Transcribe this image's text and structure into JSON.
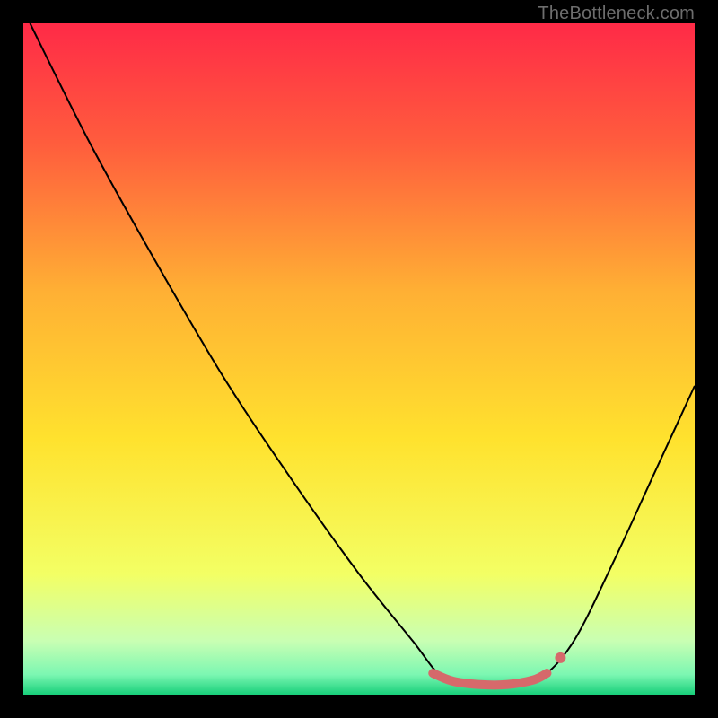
{
  "watermark": "TheBottleneck.com",
  "chart_data": {
    "type": "line",
    "title": "",
    "xlabel": "",
    "ylabel": "",
    "xlim": [
      0,
      100
    ],
    "ylim": [
      0,
      100
    ],
    "background": {
      "kind": "vertical-gradient",
      "stops": [
        {
          "pos": 0,
          "color": "#ff2a47"
        },
        {
          "pos": 18,
          "color": "#ff5d3d"
        },
        {
          "pos": 40,
          "color": "#ffb034"
        },
        {
          "pos": 62,
          "color": "#ffe22e"
        },
        {
          "pos": 82,
          "color": "#f3ff64"
        },
        {
          "pos": 92,
          "color": "#c9ffb3"
        },
        {
          "pos": 97,
          "color": "#7cf7b2"
        },
        {
          "pos": 100,
          "color": "#18cf7a"
        }
      ]
    },
    "series": [
      {
        "name": "bottleneck-curve",
        "color": "#000000",
        "stroke_width": 2,
        "points": [
          {
            "x": 1,
            "y": 100
          },
          {
            "x": 10,
            "y": 82
          },
          {
            "x": 20,
            "y": 64
          },
          {
            "x": 30,
            "y": 47
          },
          {
            "x": 40,
            "y": 32
          },
          {
            "x": 50,
            "y": 18
          },
          {
            "x": 58,
            "y": 8
          },
          {
            "x": 62,
            "y": 3
          },
          {
            "x": 66,
            "y": 1.5
          },
          {
            "x": 72,
            "y": 1.5
          },
          {
            "x": 77,
            "y": 2.5
          },
          {
            "x": 82,
            "y": 8
          },
          {
            "x": 88,
            "y": 20
          },
          {
            "x": 94,
            "y": 33
          },
          {
            "x": 100,
            "y": 46
          }
        ]
      }
    ],
    "highlight": {
      "name": "flat-zone",
      "color": "#d6696b",
      "stroke_width": 10,
      "points": [
        {
          "x": 61,
          "y": 3.2
        },
        {
          "x": 64,
          "y": 2.0
        },
        {
          "x": 68,
          "y": 1.5
        },
        {
          "x": 72,
          "y": 1.5
        },
        {
          "x": 76,
          "y": 2.2
        },
        {
          "x": 78,
          "y": 3.2
        }
      ],
      "marker": {
        "x": 80,
        "y": 5.5,
        "r": 6
      }
    }
  }
}
